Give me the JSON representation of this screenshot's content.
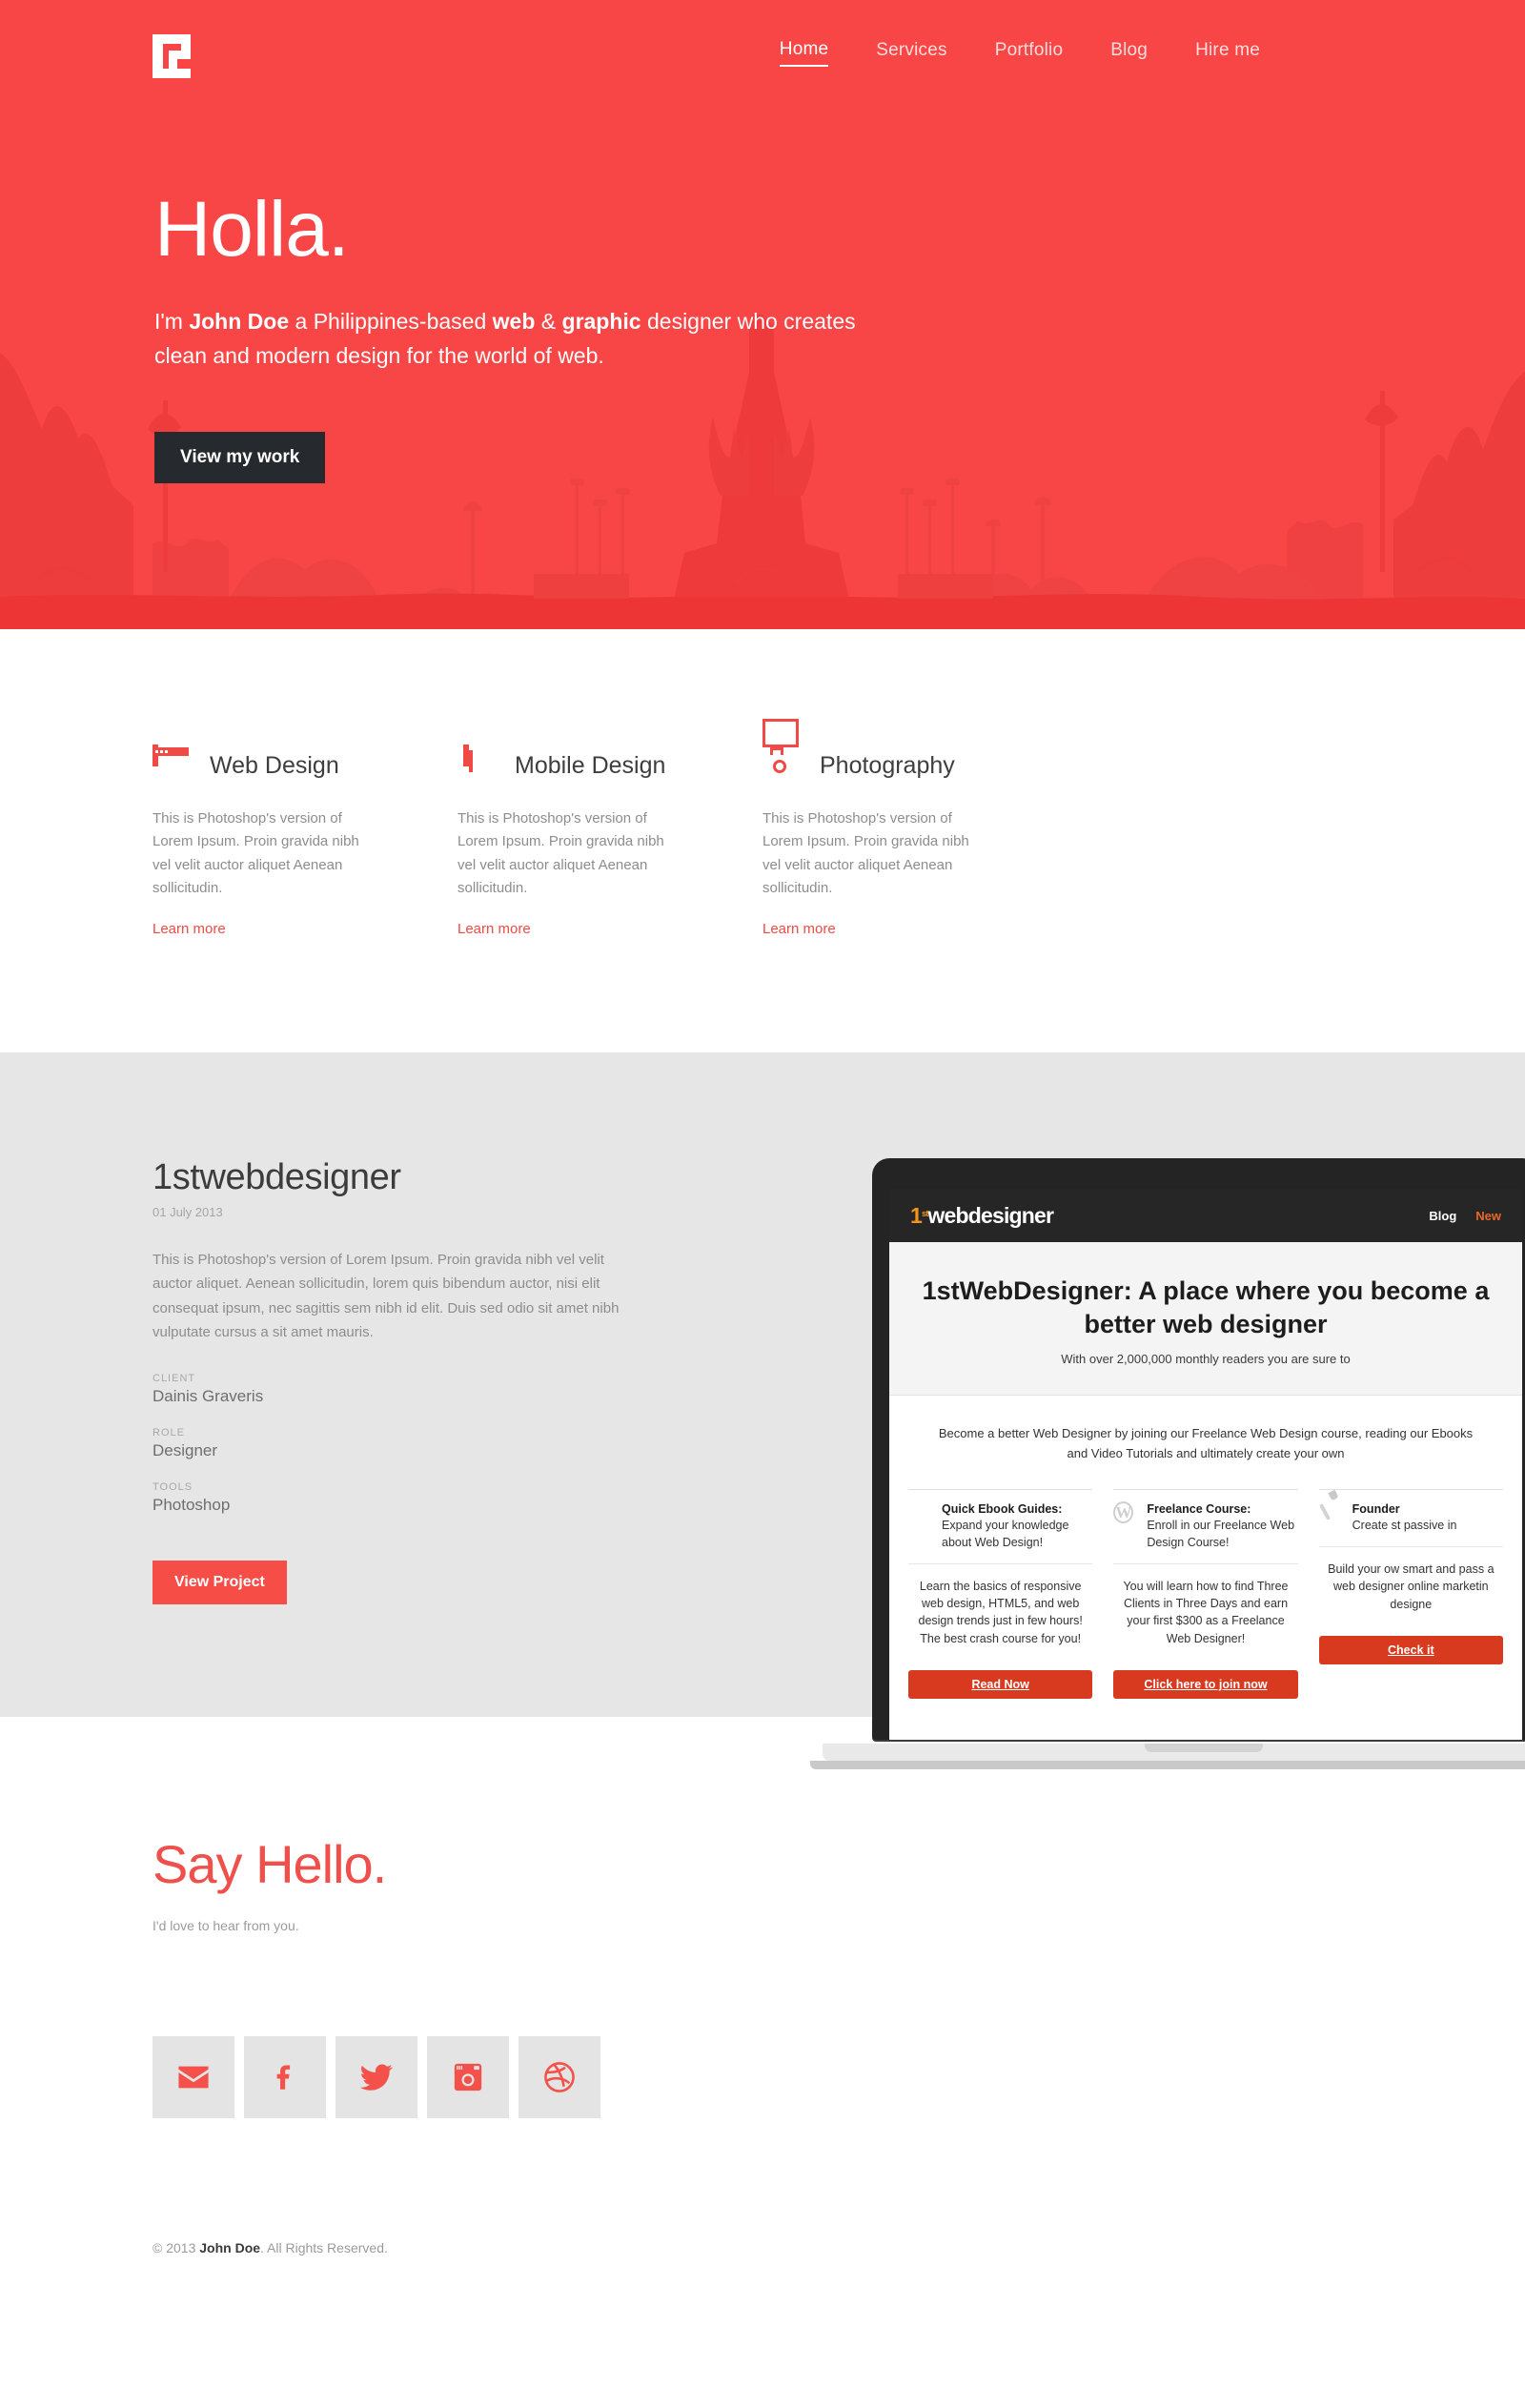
{
  "colors": {
    "brand_red": "#f84545",
    "accent_red": "#f0504b",
    "dark": "#262a2e",
    "gray_section": "#e6e6e6"
  },
  "header": {
    "logo_alt": "G monogram logo",
    "nav": [
      {
        "label": "Home",
        "active": true
      },
      {
        "label": "Services",
        "active": false
      },
      {
        "label": "Portfolio",
        "active": false
      },
      {
        "label": "Blog",
        "active": false
      },
      {
        "label": "Hire me",
        "active": false
      }
    ]
  },
  "hero": {
    "title": "Holla.",
    "intro_1": "I'm ",
    "intro_name": "John Doe",
    "intro_2": " a Philippines-based ",
    "intro_web": "web",
    "intro_3": " & ",
    "intro_graphic": "graphic",
    "intro_4": " designer who creates clean and modern design for the world of web.",
    "cta": "View my work"
  },
  "services": [
    {
      "icon": "browser-icon",
      "title": "Web Design",
      "body": "This is Photoshop's version  of Lorem Ipsum. Proin gravida nibh vel velit auctor aliquet Aenean sollicitudin.",
      "link": "Learn more"
    },
    {
      "icon": "mobile-icon",
      "title": "Mobile Design",
      "body": "This is Photoshop's version  of Lorem Ipsum. Proin gravida nibh vel velit auctor aliquet Aenean sollicitudin.",
      "link": "Learn more"
    },
    {
      "icon": "camera-icon",
      "title": "Photography",
      "body": "This is Photoshop's version  of Lorem Ipsum. Proin gravida nibh vel velit auctor aliquet Aenean sollicitudin.",
      "link": "Learn more"
    }
  ],
  "portfolio": {
    "title": "1stwebdesigner",
    "date": "01 July 2013",
    "description": "This is Photoshop's version  of Lorem Ipsum. Proin gravida nibh vel velit auctor aliquet. Aenean sollicitudin, lorem quis bibendum auctor, nisi elit consequat ipsum, nec sagittis sem nibh id elit. Duis sed odio sit amet nibh vulputate cursus a sit amet mauris.",
    "meta": [
      {
        "label": "CLIENT",
        "value": "Dainis Graveris"
      },
      {
        "label": "ROLE",
        "value": "Designer"
      },
      {
        "label": "TOOLS",
        "value": "Photoshop"
      }
    ],
    "cta": "View Project",
    "mockup": {
      "brand_one": "1",
      "brand_sup": "st",
      "brand_rest": "webdesigner",
      "nav": [
        {
          "label": "Blog",
          "highlight": false
        },
        {
          "label": "New",
          "highlight": true
        }
      ],
      "headline": "1stWebDesigner: A place where you become a better web designer",
      "subhead": "With over 2,000,000 monthly readers you are sure to",
      "lead": "Become a better Web Designer by joining our Freelance Web Design course, reading our Ebooks and Video Tutorials and ultimately create your own",
      "cards": [
        {
          "icon": "pdf-icon",
          "title": "Quick Ebook Guides:",
          "subtitle": "Expand your knowledge about Web Design!",
          "body": "Learn the basics of responsive web design, HTML5, and web design trends just in few hours! The best crash course for you!",
          "button": "Read Now"
        },
        {
          "icon": "wordpress-icon",
          "title": "Freelance Course:",
          "subtitle": "Enroll in our Freelance Web Design Course!",
          "body": "You will learn how to find Three Clients in Three Days and earn your first $300 as a Freelance Web Designer!",
          "button": "Click here to join now"
        },
        {
          "icon": "brush-icon",
          "title": "Founder",
          "subtitle": "Create st passive in",
          "body": "Build your ow smart and pass a web designer online marketin designe",
          "button": "Check it"
        }
      ]
    }
  },
  "contact": {
    "title_dark": "Say ",
    "title_accent": "Hello.",
    "subtitle": "I'd love to hear from you.",
    "socials": [
      {
        "name": "email-icon",
        "label": "Email"
      },
      {
        "name": "facebook-icon",
        "label": "Facebook"
      },
      {
        "name": "twitter-icon",
        "label": "Twitter"
      },
      {
        "name": "instagram-icon",
        "label": "Instagram"
      },
      {
        "name": "dribbble-icon",
        "label": "Dribbble"
      }
    ]
  },
  "footer": {
    "copy_pre": "© 2013 ",
    "copy_name": "John Doe",
    "copy_post": ". All Rights Reserved."
  }
}
